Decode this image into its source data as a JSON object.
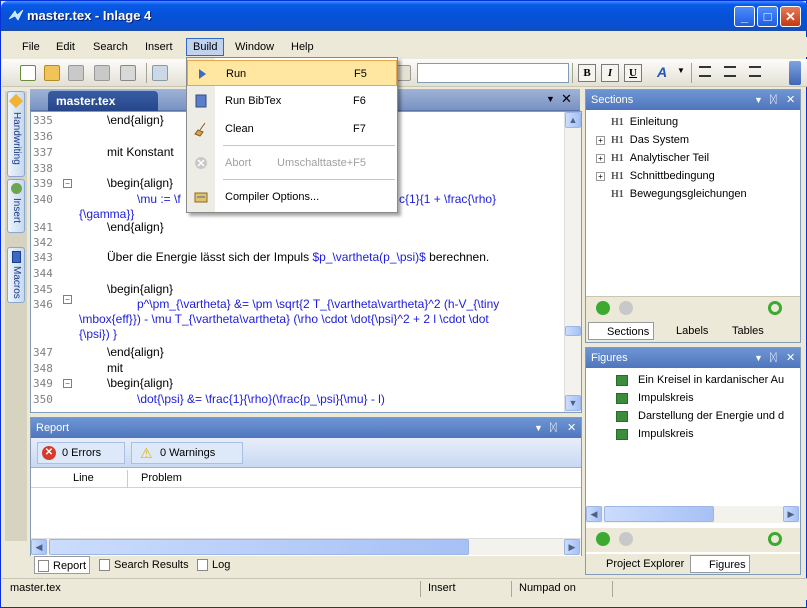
{
  "window": {
    "title": "master.tex - Inlage 4",
    "minimize": "_",
    "maximize": "□",
    "close": "✕"
  },
  "menubar": [
    "File",
    "Edit",
    "Search",
    "Insert",
    "Build",
    "Window",
    "Help"
  ],
  "left_tabs": [
    "Handwriting",
    "Insert",
    "Macros"
  ],
  "format_buttons": [
    "B",
    "I",
    "U",
    "A"
  ],
  "editor": {
    "tab": "master.tex",
    "lines": [
      {
        "n": "335",
        "t": "\\end{align}"
      },
      {
        "n": "336",
        "t": ""
      },
      {
        "n": "337",
        "t": "mit Konstant"
      },
      {
        "n": "338",
        "t": ""
      },
      {
        "n": "339",
        "t": "\\begin{align}"
      },
      {
        "n": "340",
        "t": "\\mu := \\f",
        "t2": "c{1}{1 + \\frac{\\rho}",
        "t3": "{\\gamma}}"
      },
      {
        "n": "341",
        "t": "\\end{align}"
      },
      {
        "n": "342",
        "t": ""
      },
      {
        "n": "343",
        "t": "Über die Energie lässt sich der Impuls ",
        "k": "$p_\\vartheta(p_\\psi)$",
        "t4": " berechnen."
      },
      {
        "n": "344",
        "t": ""
      },
      {
        "n": "345",
        "t": "\\begin{align}"
      },
      {
        "n": "346",
        "t": "p^\\pm_{\\vartheta} &= \\pm \\sqrt{2 T_{\\vartheta\\vartheta}^2 (h-V_{\\tiny",
        "t2": "\\mbox{eff}}) - \\mu T_{\\vartheta\\vartheta} (\\rho \\cdot \\dot{\\psi}^2 + 2 l \\cdot \\dot",
        "t3": "{\\psi}) }"
      },
      {
        "n": "347",
        "t": "\\end{align}"
      },
      {
        "n": "348",
        "t": "mit"
      },
      {
        "n": "349",
        "t": "\\begin{align}"
      },
      {
        "n": "350",
        "t": "\\dot{\\psi} &= \\frac{1}{\\rho}(\\frac{p_\\psi}{\\mu} - l)"
      }
    ]
  },
  "build_menu": {
    "items": [
      {
        "label": "Run",
        "shortcut": "F5"
      },
      {
        "label": "Run BibTex",
        "shortcut": "F6"
      },
      {
        "label": "Clean",
        "shortcut": "F7"
      },
      {
        "label": "Abort",
        "shortcut": "Umschalttaste+F5"
      },
      {
        "label": "Compiler Options...",
        "shortcut": ""
      }
    ]
  },
  "report": {
    "title": "Report",
    "errors": "0 Errors",
    "warnings": "0 Warnings",
    "col_line": "Line",
    "col_problem": "Problem",
    "tabs": [
      "Report",
      "Search Results",
      "Log"
    ]
  },
  "sections": {
    "title": "Sections",
    "h1": "H1",
    "items": [
      "Einleitung",
      "Das System",
      "Analytischer Teil",
      "Schnittbedingung",
      "Bewegungsgleichungen"
    ],
    "tabs": [
      "Sections",
      "Labels",
      "Tables"
    ]
  },
  "figures": {
    "title": "Figures",
    "items": [
      "Ein Kreisel in kardanischer Au",
      "Impulskreis",
      "Darstellung der Energie und d",
      "Impulskreis"
    ],
    "tabs": [
      "Project Explorer",
      "Figures"
    ]
  },
  "status": {
    "file": "master.tex",
    "mode": "Insert",
    "numpad": "Numpad on"
  },
  "colors": {
    "accent": "#0a5ae8",
    "keyword": "#1c1ce0",
    "highlight": "#ffe7a2"
  }
}
